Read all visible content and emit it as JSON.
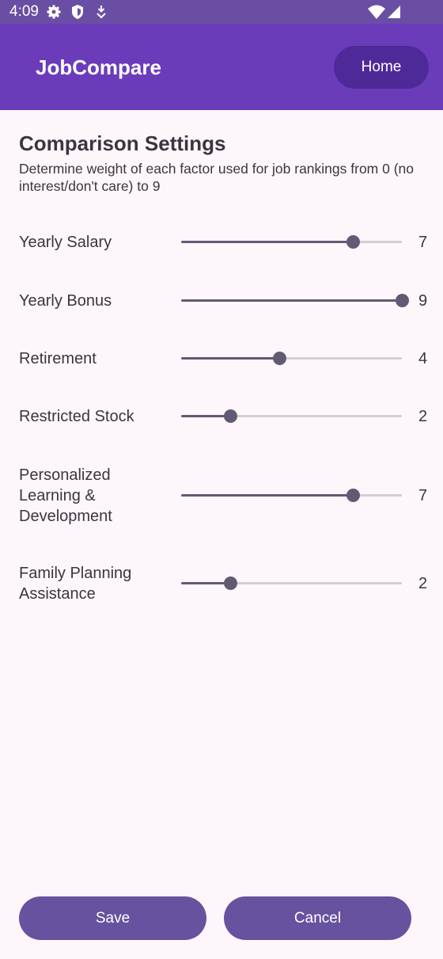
{
  "status_bar": {
    "time": "4:09",
    "icons": [
      "gear-icon",
      "shield-icon",
      "download-icon",
      "wifi-icon",
      "signal-icon"
    ]
  },
  "app_bar": {
    "title": "JobCompare",
    "home_label": "Home"
  },
  "settings": {
    "heading": "Comparison Settings",
    "description": "Determine weight of each factor used for job rankings from 0 (no interest/don't care) to 9",
    "slider_min": 0,
    "slider_max": 9,
    "factors": [
      {
        "label": "Yearly Salary",
        "value": "7"
      },
      {
        "label": "Yearly Bonus",
        "value": "9"
      },
      {
        "label": "Retirement",
        "value": "4"
      },
      {
        "label": "Restricted Stock",
        "value": "2"
      },
      {
        "label": "Personalized Learning & Development",
        "value": "7"
      },
      {
        "label": "Family Planning Assistance",
        "value": "2"
      }
    ]
  },
  "actions": {
    "save_label": "Save",
    "cancel_label": "Cancel"
  },
  "colors": {
    "app_bar": "#6a3cba",
    "status_bar": "#6a4ea3",
    "home_button": "#4d2a98",
    "action_button": "#66529f",
    "slider_active": "#605a73",
    "slider_inactive": "#d3ced6",
    "background": "#fdf7fc"
  }
}
